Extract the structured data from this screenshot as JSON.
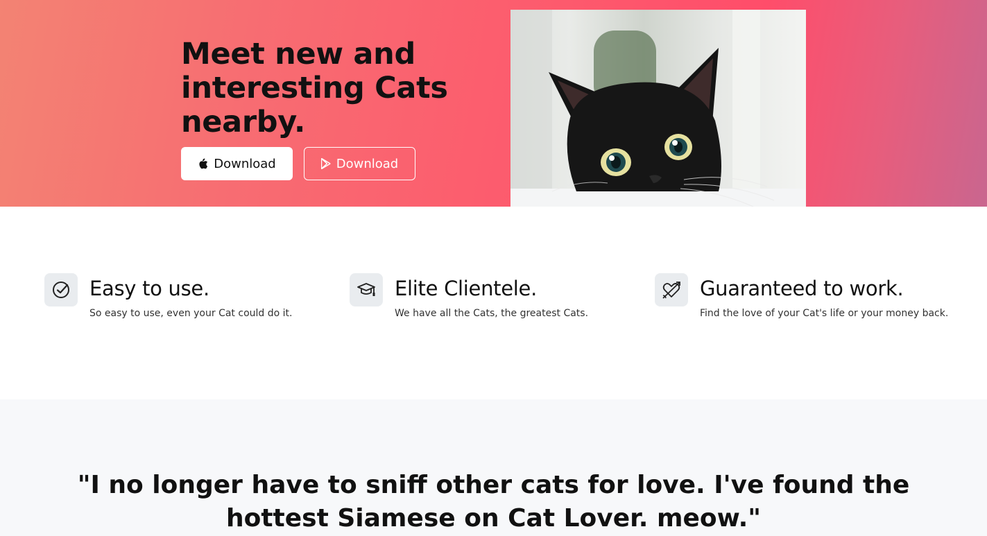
{
  "hero": {
    "title": "Meet new and interesting Cats nearby.",
    "apple_button_label": "Download",
    "play_button_label": "Download",
    "apple_icon": "apple-icon",
    "play_icon": "google-play-icon"
  },
  "features": [
    {
      "icon": "check-circle-icon",
      "title": "Easy to use.",
      "description": "So easy to use, even your Cat could do it."
    },
    {
      "icon": "graduation-cap-icon",
      "title": "Elite Clientele.",
      "description": "We have all the Cats, the greatest Cats."
    },
    {
      "icon": "heart-arrow-icon",
      "title": "Guaranteed to work.",
      "description": "Find the love of your Cat's life or your money back."
    }
  ],
  "testimonial": {
    "quote": "\"I no longer have to sniff other cats for love. I've found the hottest Siamese on Cat Lover. meow.\""
  },
  "colors": {
    "hero_gradient_start": "#f38373",
    "hero_gradient_mid": "#ff4d6a",
    "hero_gradient_end": "#c9668f",
    "icon_box_bg": "#e9ecef",
    "testimonial_bg": "#f7f8fa"
  }
}
